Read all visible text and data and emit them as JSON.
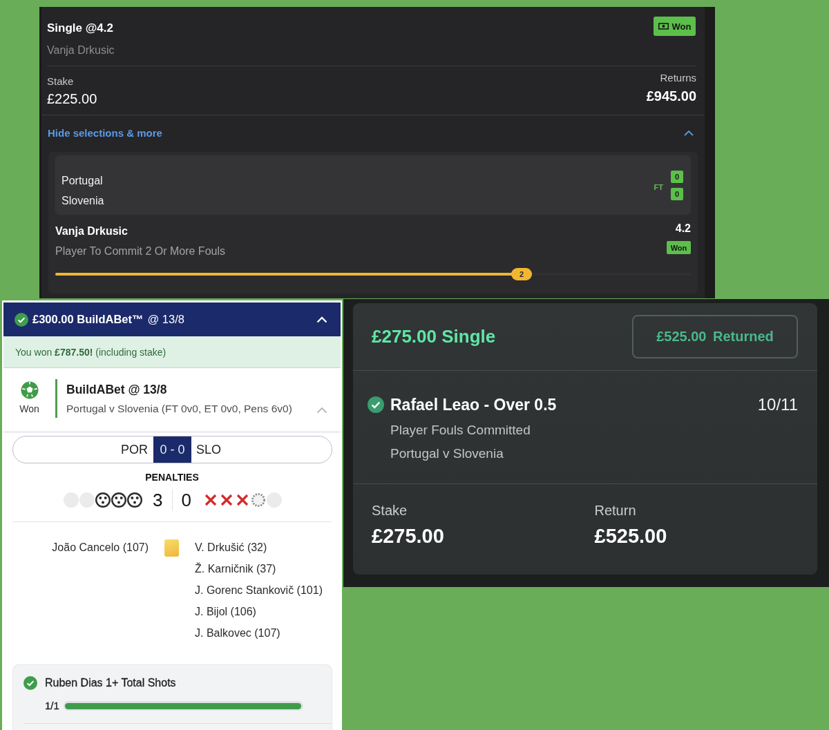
{
  "top_slip": {
    "title": "Single @4.2",
    "subtitle": "Vanja Drkusic",
    "status": "Won",
    "stake_label": "Stake",
    "stake": "£225.00",
    "returns_label": "Returns",
    "returns": "£945.00",
    "toggle_label": "Hide selections & more",
    "expanded": true,
    "match": {
      "teams": [
        {
          "name": "Portugal",
          "score": "0"
        },
        {
          "name": "Slovenia",
          "score": "0"
        }
      ],
      "period": "FT"
    },
    "selection": {
      "name": "Vanja Drkusic",
      "odds": "4.2",
      "market": "Player To Commit 2 Or More Fouls",
      "status": "Won",
      "progress": {
        "level": 0.75,
        "label": "2"
      }
    }
  },
  "buildabet_slip": {
    "won": true,
    "title": "£300.00 BuildABet™",
    "odds": "@ 13/8",
    "expanded": true,
    "win_message": "You won **£787.50!** (including stake)",
    "leg": {
      "status": "Won",
      "title": "BuildABet @ 13/8",
      "event": "Portugal v Slovenia (FT 0v0, ET 0v0, Pens 6v0)",
      "expanded": true
    },
    "scoreline": {
      "home": "POR",
      "score": "0 - 0",
      "away": "SLO"
    },
    "penalties": {
      "title": "PENALTIES",
      "home_score": "3",
      "away_score": "0",
      "home_kicks": [
        {
          "kind": "blank"
        },
        {
          "kind": "blank"
        },
        {
          "kind": "scored"
        },
        {
          "kind": "scored"
        },
        {
          "kind": "scored"
        }
      ],
      "away_kicks": [
        {
          "kind": "missed"
        },
        {
          "kind": "missed"
        },
        {
          "kind": "missed"
        },
        {
          "kind": "pending"
        },
        {
          "kind": "blank"
        }
      ]
    },
    "bookings": {
      "home": [
        "João Cancelo (107)"
      ],
      "away": [
        "V. Drkušić (32)",
        "Ž. Karničnik (37)",
        "J. Gorenc Stankovič (101)",
        "J. Bijol (106)",
        "J. Balkovec (107)"
      ]
    },
    "selections": [
      {
        "won": true,
        "label": "Ruben Dias 1+ Total Shots",
        "count": "1/1",
        "level": 1
      }
    ]
  },
  "single_slip": {
    "title": "£275.00 Single",
    "returned_button": "£525.00 Returned",
    "leg": {
      "won": true,
      "title": "Rafael Leao - Over 0.5",
      "odds": "10/11",
      "market": "Player Fouls Committed",
      "event": "Portugal v Slovenia"
    },
    "stake_label": "Stake",
    "stake": "£275.00",
    "return_label": "Return",
    "return": "£525.00"
  }
}
